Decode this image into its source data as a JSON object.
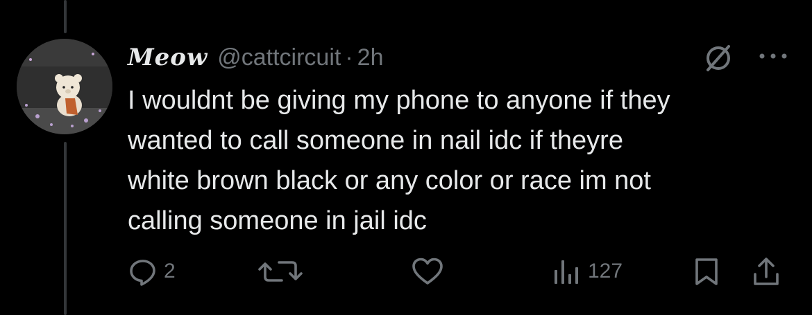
{
  "tweet": {
    "display_name": "Meow",
    "handle": "@cattcircuit",
    "separator": "·",
    "time": "2h",
    "text": "I wouldnt be giving my phone to anyone if they\nwanted to call someone in nail idc if theyre\nwhite brown black or any color or race im not\ncalling someone in jail idc"
  },
  "actions": {
    "replies": "2",
    "views": "127"
  },
  "icons": {
    "reply": "speech-bubble-icon",
    "retweet": "retweet-arrows-icon",
    "like": "heart-icon",
    "views": "bar-chart-icon",
    "bookmark": "bookmark-icon",
    "share": "share-upload-icon",
    "mute": "circle-slash-icon",
    "more": "ellipsis-icon"
  },
  "colors": {
    "background": "#000000",
    "primary_text": "#e7e9ea",
    "secondary_text": "#71767b",
    "thread_line": "#333639"
  }
}
